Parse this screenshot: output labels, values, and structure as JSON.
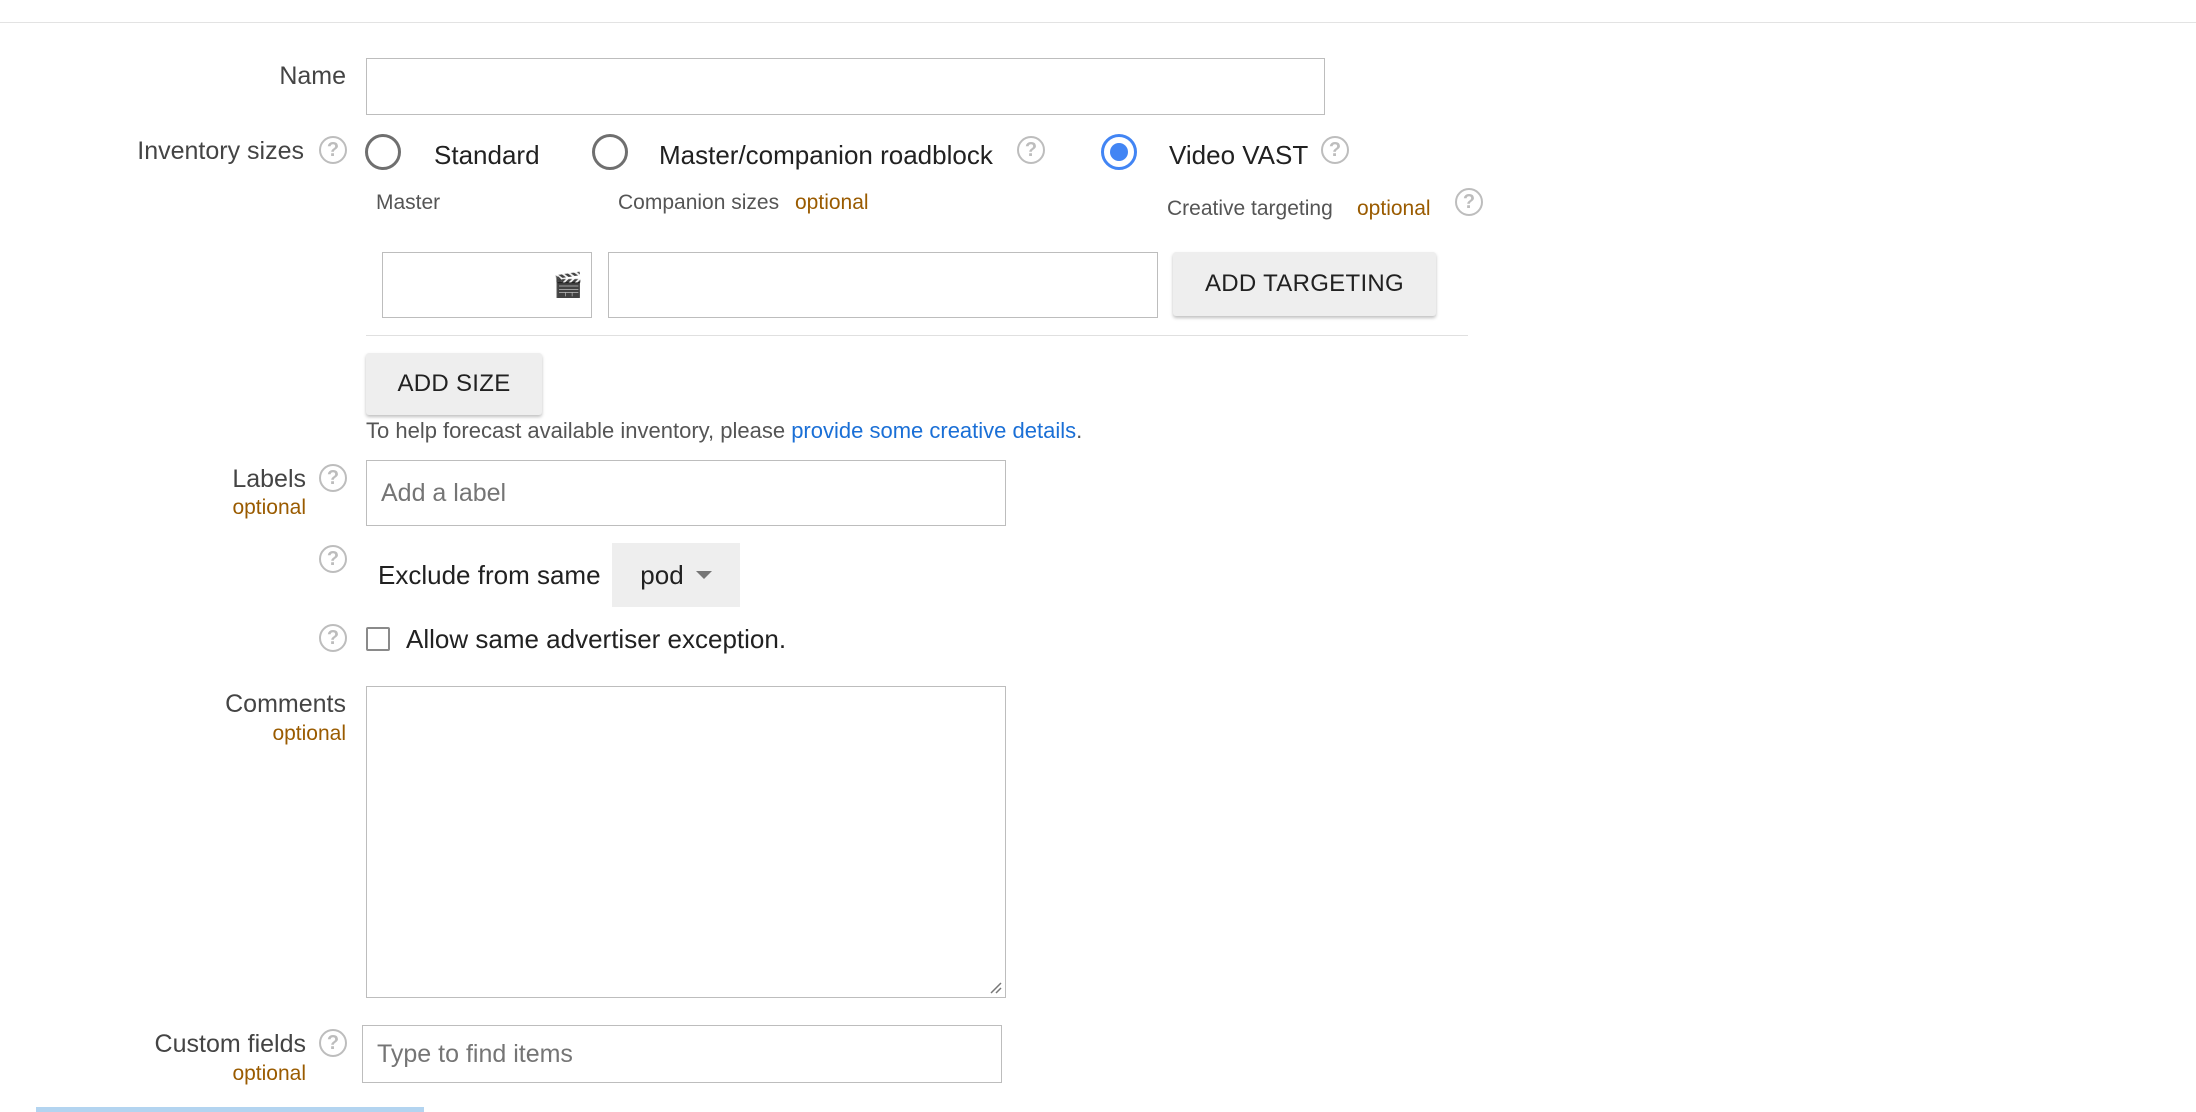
{
  "form": {
    "name": {
      "label": "Name",
      "value": ""
    },
    "inventory_sizes": {
      "label": "Inventory sizes",
      "options": [
        {
          "label": "Standard",
          "selected": false
        },
        {
          "label": "Master/companion roadblock",
          "selected": false
        },
        {
          "label": "Video VAST",
          "selected": true
        }
      ],
      "master_label": "Master",
      "companion_label": "Companion sizes",
      "companion_optional": "optional",
      "creative_targeting_label": "Creative targeting",
      "creative_targeting_optional": "optional",
      "add_targeting_button": "ADD TARGETING",
      "add_size_button": "ADD SIZE",
      "forecast_text": "To help forecast available inventory, please ",
      "forecast_link": "provide some creative details",
      "forecast_end": "."
    },
    "labels": {
      "label": "Labels",
      "optional": "optional",
      "placeholder": "Add a label"
    },
    "exclude": {
      "text": "Exclude from same",
      "select_value": "pod"
    },
    "allow_exception": {
      "text": "Allow same advertiser exception.",
      "checked": false
    },
    "comments": {
      "label": "Comments",
      "optional": "optional",
      "value": ""
    },
    "custom_fields": {
      "label": "Custom fields",
      "optional": "optional",
      "placeholder": "Type to find items"
    }
  },
  "icons": {
    "help": "?",
    "video": "🎬"
  },
  "colors": {
    "accent": "#4285f4",
    "optional": "#9a5b00",
    "link": "#1a6fd6"
  }
}
